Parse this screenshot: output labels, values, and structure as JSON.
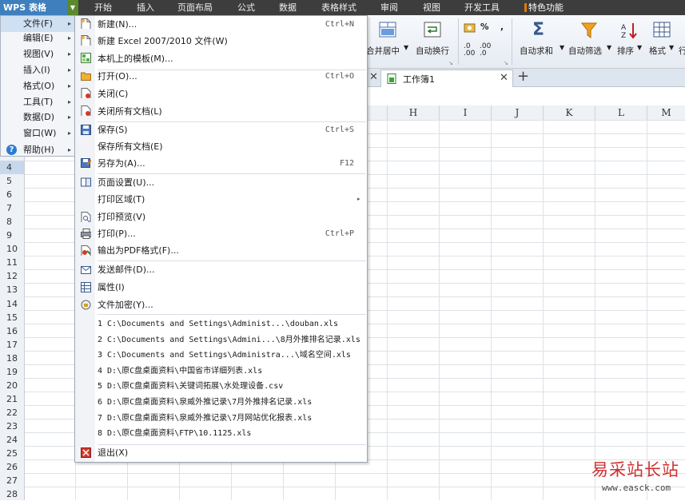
{
  "app": {
    "logo": "WPS 表格"
  },
  "top_tabs": [
    {
      "label": "开始"
    },
    {
      "label": "插入"
    },
    {
      "label": "页面布局"
    },
    {
      "label": "公式"
    },
    {
      "label": "数据"
    },
    {
      "label": "表格样式"
    },
    {
      "label": "审阅"
    },
    {
      "label": "视图"
    },
    {
      "label": "开发工具"
    },
    {
      "label": "特色功能"
    }
  ],
  "ribbon": {
    "merge_center": "合并居中",
    "auto_wrap": "自动换行",
    "percent": "%",
    "auto_sum": "自动求和",
    "auto_filter": "自动筛选",
    "sort": "排序",
    "format": "格式",
    "row": "行"
  },
  "doc_tab": {
    "label": "工作簿1",
    "add": "+"
  },
  "columns": [
    "H",
    "I",
    "J",
    "K",
    "L",
    "M"
  ],
  "rows": [
    "4",
    "5",
    "6",
    "7",
    "8",
    "9",
    "10",
    "11",
    "12",
    "13",
    "14",
    "15",
    "16",
    "17",
    "18",
    "19",
    "20",
    "21",
    "22",
    "23",
    "24",
    "25",
    "26",
    "27",
    "28"
  ],
  "main_menu": [
    {
      "label": "文件(F)"
    },
    {
      "label": "编辑(E)"
    },
    {
      "label": "视图(V)"
    },
    {
      "label": "插入(I)"
    },
    {
      "label": "格式(O)"
    },
    {
      "label": "工具(T)"
    },
    {
      "label": "数据(D)"
    },
    {
      "label": "窗口(W)"
    },
    {
      "label": "帮助(H)"
    }
  ],
  "file_menu": {
    "new": {
      "label": "新建(N)...",
      "shortcut": "Ctrl+N"
    },
    "new_excel": {
      "label": "新建 Excel 2007/2010 文件(W)"
    },
    "templates": {
      "label": "本机上的模板(M)..."
    },
    "open": {
      "label": "打开(O)...",
      "shortcut": "Ctrl+O"
    },
    "close": {
      "label": "关闭(C)"
    },
    "close_all": {
      "label": "关闭所有文档(L)"
    },
    "save": {
      "label": "保存(S)",
      "shortcut": "Ctrl+S"
    },
    "save_all": {
      "label": "保存所有文档(E)"
    },
    "save_as": {
      "label": "另存为(A)...",
      "shortcut": "F12"
    },
    "page_setup": {
      "label": "页面设置(U)..."
    },
    "print_area": {
      "label": "打印区域(T)"
    },
    "print_preview": {
      "label": "打印预览(V)"
    },
    "print": {
      "label": "打印(P)...",
      "shortcut": "Ctrl+P"
    },
    "export_pdf": {
      "label": "输出为PDF格式(F)..."
    },
    "send_mail": {
      "label": "发送邮件(D)..."
    },
    "properties": {
      "label": "属性(I)"
    },
    "encrypt": {
      "label": "文件加密(Y)..."
    },
    "recent": [
      "1 C:\\Documents and Settings\\Administ...\\douban.xls",
      "2 C:\\Documents and Settings\\Admini...\\8月外推排名记录.xls",
      "3 C:\\Documents and Settings\\Administra...\\域名空间.xls",
      "4 D:\\原C盘桌面资料\\中国省市详细列表.xls",
      "5 D:\\原C盘桌面资料\\关键词拓展\\水处理设备.csv",
      "6 D:\\原C盘桌面资料\\泉威外推记录\\7月外推排名记录.xls",
      "7 D:\\原C盘桌面资料\\泉威外推记录\\7月网站优化报表.xls",
      "8 D:\\原C盘桌面资料\\FTP\\10.1125.xls"
    ],
    "exit": {
      "label": "退出(X)"
    }
  },
  "watermark": {
    "title": "易采站长站",
    "url": "www.easck.com"
  }
}
